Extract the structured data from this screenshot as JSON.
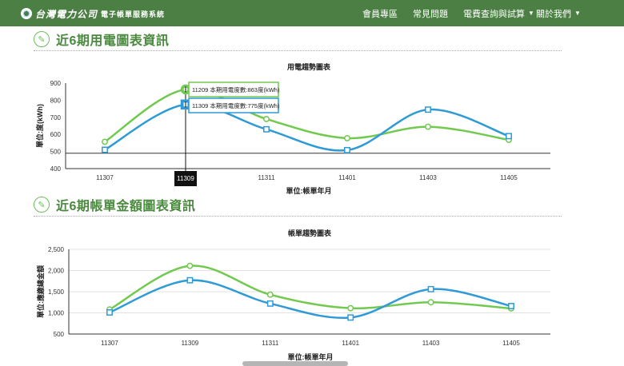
{
  "header": {
    "brand": "台灣電力公司",
    "subtitle": "電子帳單服務系統",
    "nav": [
      {
        "label": "會員專區",
        "dropdown": false
      },
      {
        "label": "常見問題",
        "dropdown": false
      },
      {
        "label": "電費查詢與試算",
        "dropdown": true
      },
      {
        "label": "關於我們",
        "dropdown": true
      }
    ]
  },
  "sections": [
    {
      "title": "近6期用電圖表資訊"
    },
    {
      "title": "近6期帳單金額圖表資訊"
    }
  ],
  "chart_data": [
    {
      "type": "line",
      "title": "用電趨勢圖表",
      "xlabel": "單位:帳單年月",
      "ylabel": "單位:度(kWh)",
      "categories": [
        "11307",
        "11309",
        "11311",
        "11401",
        "11403",
        "11405"
      ],
      "ylim": [
        400,
        900
      ],
      "yticks": [
        400,
        500,
        600,
        700,
        800,
        900
      ],
      "grid": false,
      "smooth": true,
      "series": [
        {
          "color": "#72c94f",
          "marker": "circle",
          "values": [
            557,
            863,
            690,
            578,
            645,
            568
          ]
        },
        {
          "color": "#2f9ad6",
          "marker": "square",
          "values": [
            510,
            775,
            630,
            508,
            745,
            590
          ]
        }
      ],
      "crosshair_label": "11309",
      "tooltips": [
        {
          "text": "11209 本期用電度數:863度(kWh)",
          "color": "#72c94f"
        },
        {
          "text": "11309 本期用電度數:775度(kWh)",
          "color": "#2f9ad6"
        }
      ]
    },
    {
      "type": "line",
      "title": "帳單趨勢圖表",
      "xlabel": "單位:帳單年月",
      "ylabel": "單位:應繳總金額",
      "categories": [
        "11307",
        "11309",
        "11311",
        "11401",
        "11403",
        "11405"
      ],
      "ylim": [
        500,
        2500
      ],
      "yticks": [
        "500",
        "1,000",
        "1,500",
        "2,000",
        "2,500"
      ],
      "grid": true,
      "smooth": true,
      "series": [
        {
          "color": "#72c94f",
          "marker": "circle",
          "values": [
            1080,
            2110,
            1430,
            1110,
            1250,
            1105
          ]
        },
        {
          "color": "#2f9ad6",
          "marker": "square",
          "values": [
            1010,
            1770,
            1220,
            890,
            1560,
            1160
          ]
        }
      ]
    }
  ]
}
